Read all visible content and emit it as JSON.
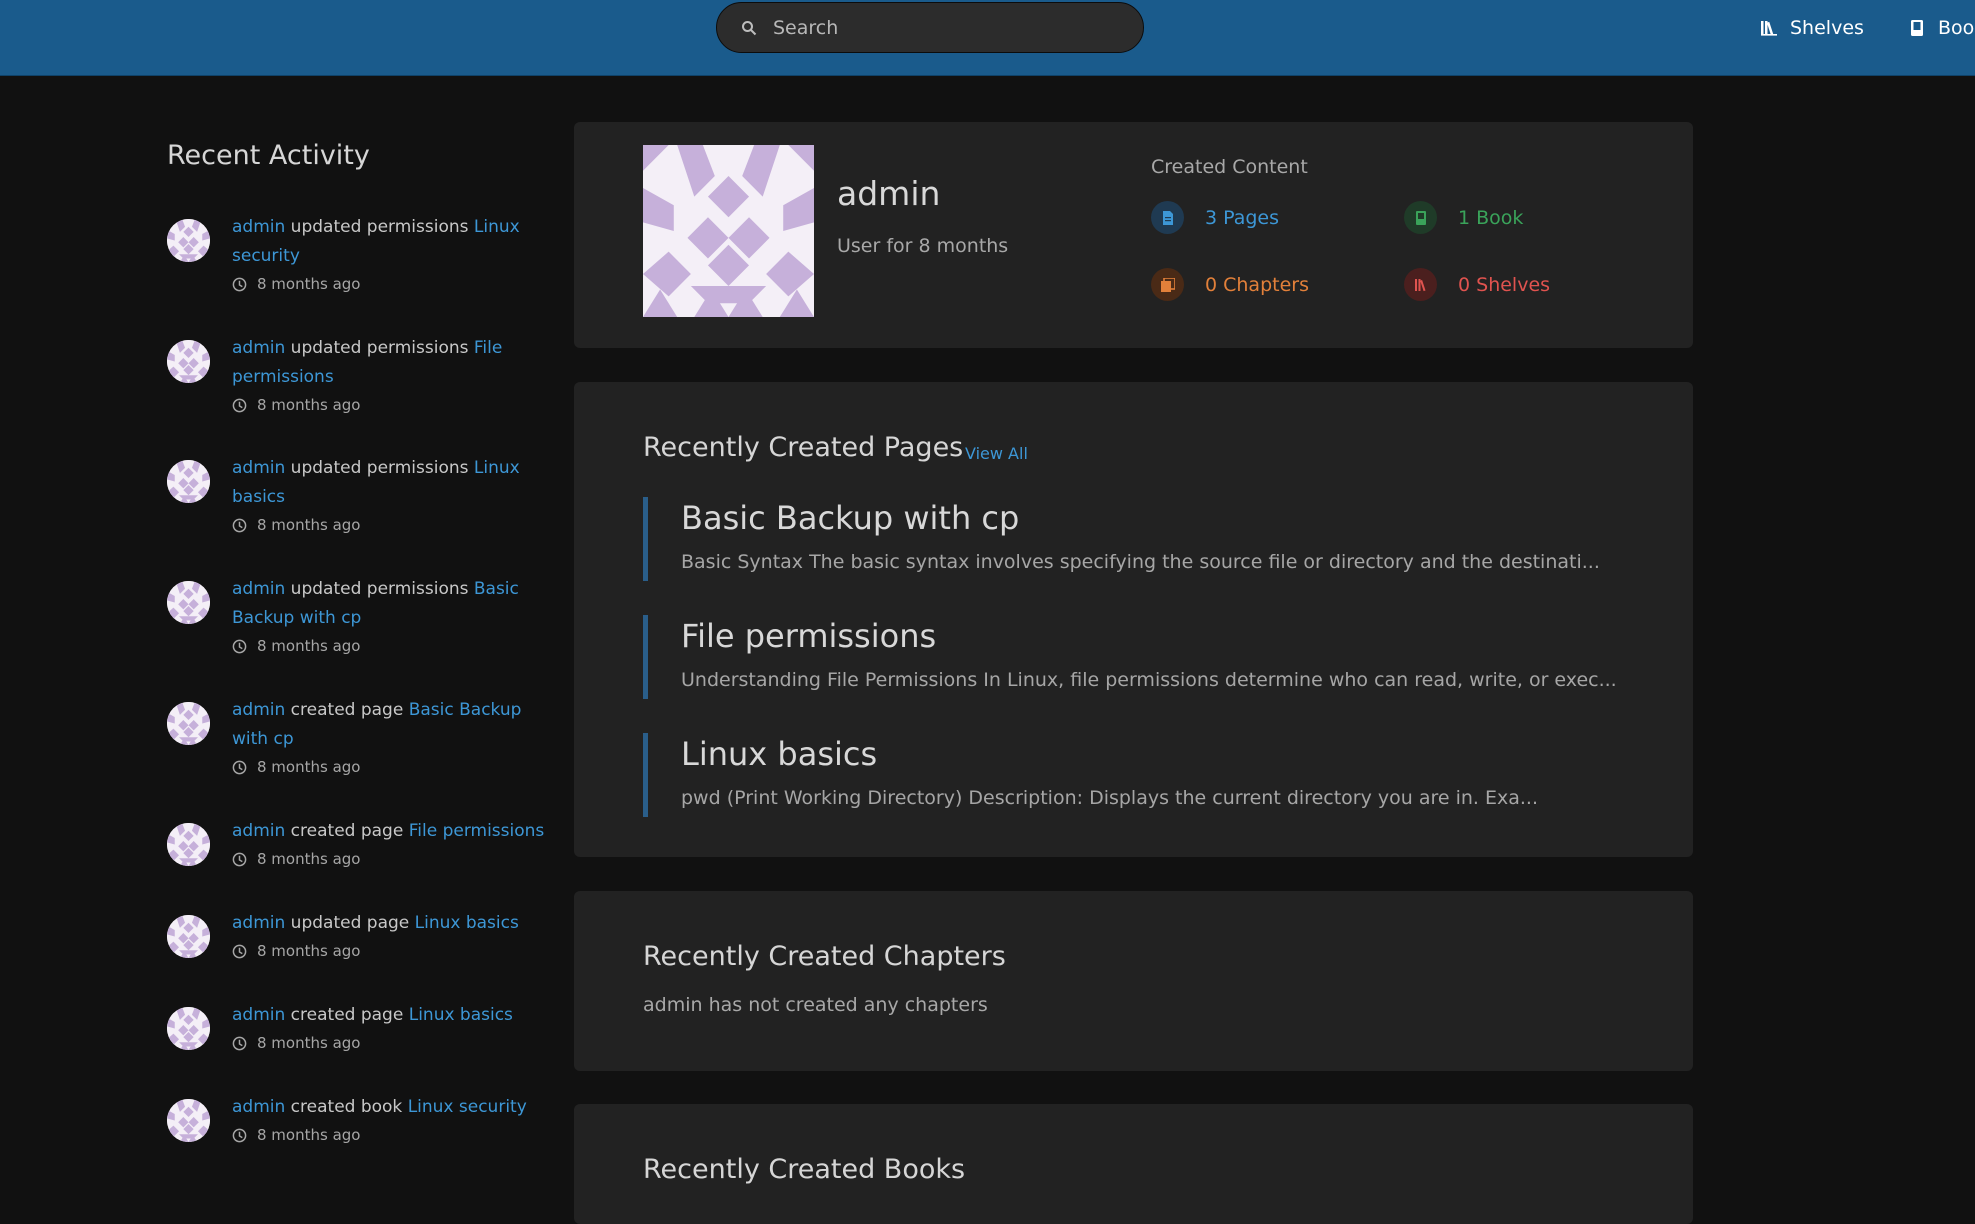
{
  "header": {
    "search_placeholder": "Search",
    "nav": [
      {
        "label": "Shelves",
        "icon": "shelves-icon"
      },
      {
        "label": "Books",
        "icon": "book-icon"
      }
    ]
  },
  "recent_activity": {
    "title": "Recent Activity",
    "items": [
      {
        "user": "admin",
        "action": " updated permissions ",
        "target": "Linux security",
        "time": "8 months ago"
      },
      {
        "user": "admin",
        "action": " updated permissions ",
        "target": "File permissions",
        "time": "8 months ago"
      },
      {
        "user": "admin",
        "action": " updated permissions ",
        "target": "Linux basics",
        "time": "8 months ago"
      },
      {
        "user": "admin",
        "action": " updated permissions ",
        "target": "Basic Backup with cp",
        "time": "8 months ago"
      },
      {
        "user": "admin",
        "action": " created page ",
        "target": "Basic Backup with cp",
        "time": "8 months ago"
      },
      {
        "user": "admin",
        "action": " created page ",
        "target": "File permissions",
        "time": "8 months ago"
      },
      {
        "user": "admin",
        "action": " updated page ",
        "target": "Linux basics",
        "time": "8 months ago"
      },
      {
        "user": "admin",
        "action": " created page ",
        "target": "Linux basics",
        "time": "8 months ago"
      },
      {
        "user": "admin",
        "action": " created book ",
        "target": "Linux security",
        "time": "8 months ago"
      }
    ]
  },
  "profile": {
    "name": "admin",
    "since": "User for 8 months",
    "created_content_title": "Created Content",
    "stats": {
      "pages": {
        "label": "3 Pages",
        "color": "#3d97d6"
      },
      "books": {
        "label": "1 Book",
        "color": "#3aa35a"
      },
      "chapters": {
        "label": "0 Chapters",
        "color": "#e2803a"
      },
      "shelves": {
        "label": "0 Shelves",
        "color": "#e0534f"
      }
    }
  },
  "recent_pages": {
    "title": "Recently Created Pages",
    "view_all": "View All",
    "items": [
      {
        "title": "Basic Backup with cp",
        "excerpt": "Basic Syntax The basic syntax involves specifying the source file or directory and the destinati..."
      },
      {
        "title": "File permissions",
        "excerpt": "Understanding File Permissions In Linux, file permissions determine who can read, write, or exec..."
      },
      {
        "title": "Linux basics",
        "excerpt": "pwd (Print Working Directory) Description: Displays the current directory you are in. Exa..."
      }
    ]
  },
  "recent_chapters": {
    "title": "Recently Created Chapters",
    "empty": "admin has not created any chapters"
  },
  "recent_books": {
    "title": "Recently Created Books"
  }
}
